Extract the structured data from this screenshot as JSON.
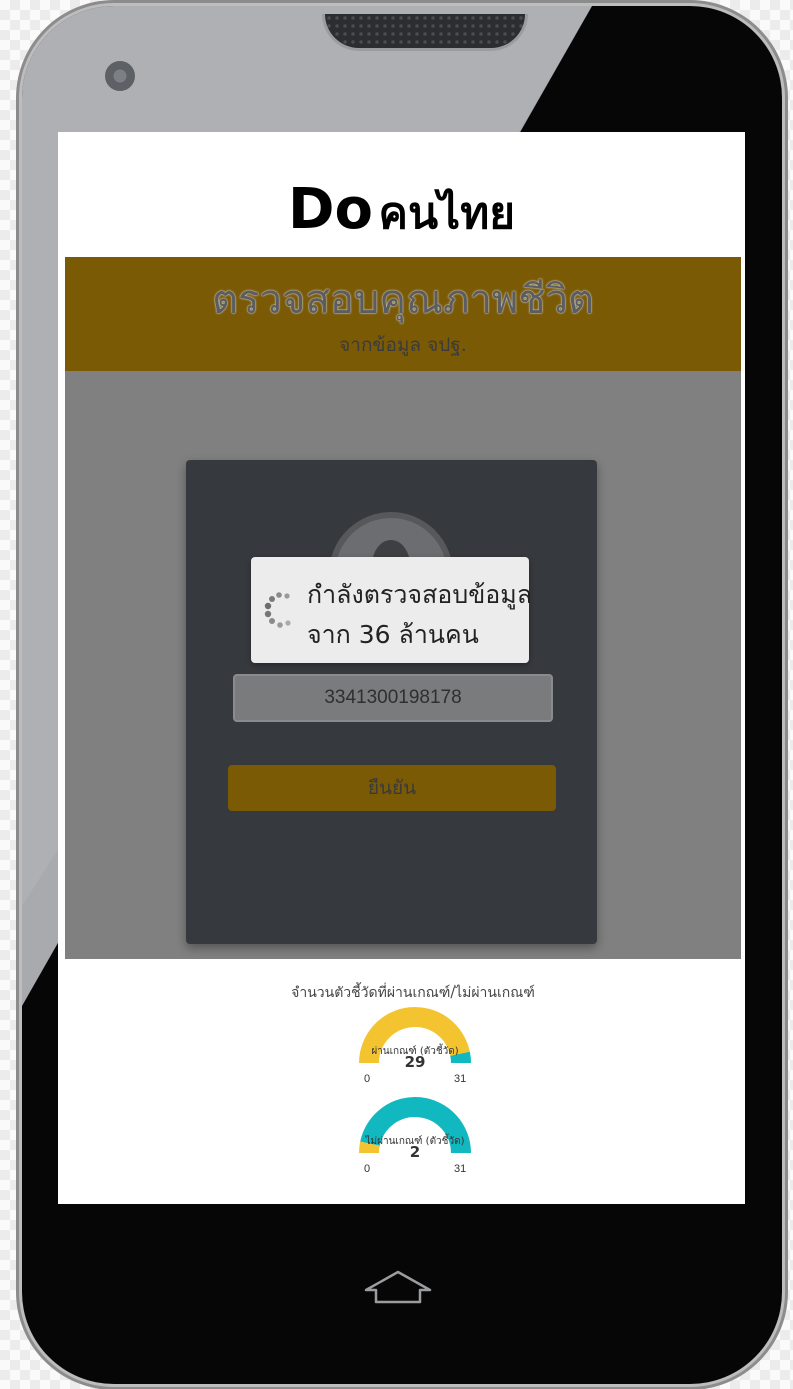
{
  "headline": {
    "en": "Do",
    "th": "คนไทย"
  },
  "app": {
    "banner_title": "ตรวจสอบคุณภาพชีวิต",
    "banner_subtitle": "จากข้อมูล จปฐ.",
    "id_value": "3341300198178",
    "confirm_label": "ยืนยัน",
    "loading_line1": "กำลังตรวจสอบข้อมูล",
    "loading_line2": "จาก 36 ล้านคน"
  },
  "stats": {
    "title": "จำนวนตัวชี้วัดที่ผ่านเกณฑ์/ไม่ผ่านเกณฑ์",
    "gauges": [
      {
        "label": "ผ่านเกณฑ์ (ตัวชี้วัด)",
        "value": "29",
        "min": "0",
        "max": "31",
        "fill_fraction": 0.935,
        "fill_color": "#f4c430",
        "rest_color": "#11b8bf"
      },
      {
        "label": "ไม่ผ่านเกณฑ์ (ตัวชี้วัด)",
        "value": "2",
        "min": "0",
        "max": "31",
        "fill_fraction": 0.065,
        "fill_color": "#f4c430",
        "rest_color": "#11b8bf"
      }
    ]
  },
  "colors": {
    "banner": "#7b5a06",
    "card": "#36393d",
    "overlay": "#808080"
  },
  "icons": {
    "home": "home-outline-icon",
    "spinner": "loading-spinner-icon",
    "avatar": "user-avatar-icon",
    "camera": "front-camera-icon"
  }
}
